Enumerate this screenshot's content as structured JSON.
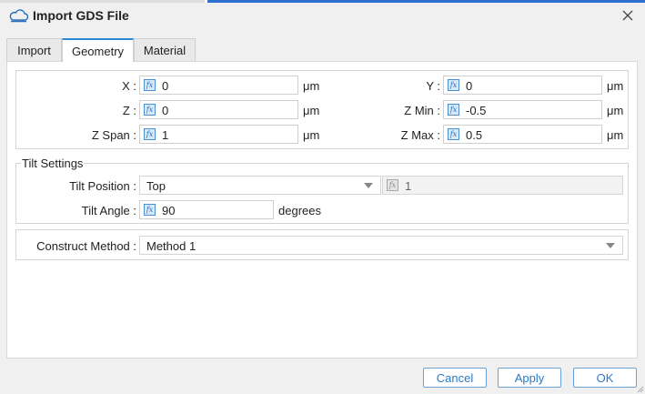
{
  "window": {
    "title": "Import GDS File"
  },
  "tabs": [
    {
      "label": "Import",
      "active": false
    },
    {
      "label": "Geometry",
      "active": true
    },
    {
      "label": "Material",
      "active": false
    }
  ],
  "geometry": {
    "x": {
      "label": "X :",
      "value": "0",
      "unit": "μm"
    },
    "y": {
      "label": "Y :",
      "value": "0",
      "unit": "μm"
    },
    "z": {
      "label": "Z :",
      "value": "0",
      "unit": "μm"
    },
    "z_min": {
      "label": "Z Min :",
      "value": "-0.5",
      "unit": "μm"
    },
    "z_span": {
      "label": "Z Span :",
      "value": "1",
      "unit": "μm"
    },
    "z_max": {
      "label": "Z Max :",
      "value": "0.5",
      "unit": "μm"
    }
  },
  "tilt": {
    "group_title": "Tilt Settings",
    "position": {
      "label": "Tilt Position :",
      "selected": "Top",
      "extra_value": "1"
    },
    "angle": {
      "label": "Tilt Angle :",
      "value": "90",
      "unit": "degrees"
    }
  },
  "construct": {
    "label": "Construct Method :",
    "selected": "Method 1"
  },
  "buttons": {
    "cancel": "Cancel",
    "apply": "Apply",
    "ok": "OK"
  },
  "colors": {
    "accent": "#2a7bc8",
    "tab_highlight": "#2a8ad8",
    "fx_icon": "#4a8fd0"
  }
}
